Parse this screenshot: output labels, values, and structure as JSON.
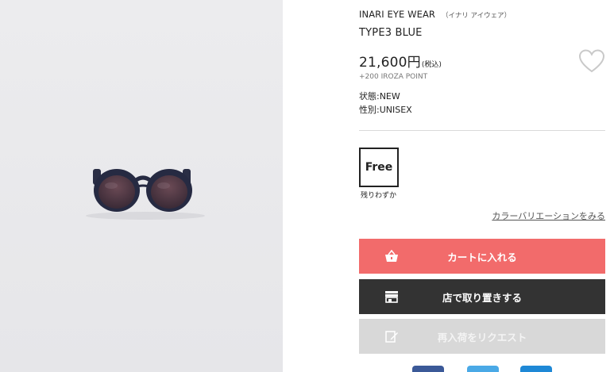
{
  "product": {
    "brand": "INARI EYE WEAR",
    "brand_kana": "（イナリ アイウェア）",
    "name": "TYPE3 BLUE",
    "price": "21,600円",
    "tax_note": "(税込)",
    "points": "+200 IROZA POINT",
    "condition": "状態:NEW",
    "gender": "性別:UNISEX"
  },
  "size": {
    "label": "Free",
    "stock_note": "残りわずか"
  },
  "links": {
    "color_variation": "カラーバリエーションをみる"
  },
  "buttons": {
    "cart": "カートに入れる",
    "store_hold": "店で取り置きする",
    "restock_request": "再入荷をリクエスト"
  },
  "icons": {
    "favorite": "heart-outline-icon",
    "cart": "basket-icon",
    "store": "store-icon",
    "restock": "edit-note-icon"
  },
  "colors": {
    "cart_button": "#f26b6b",
    "store_button": "#333333",
    "restock_button": "#d8d8d8",
    "facebook": "#3b5998",
    "twitter": "#4aa9e6",
    "line": "#1e88d6"
  }
}
